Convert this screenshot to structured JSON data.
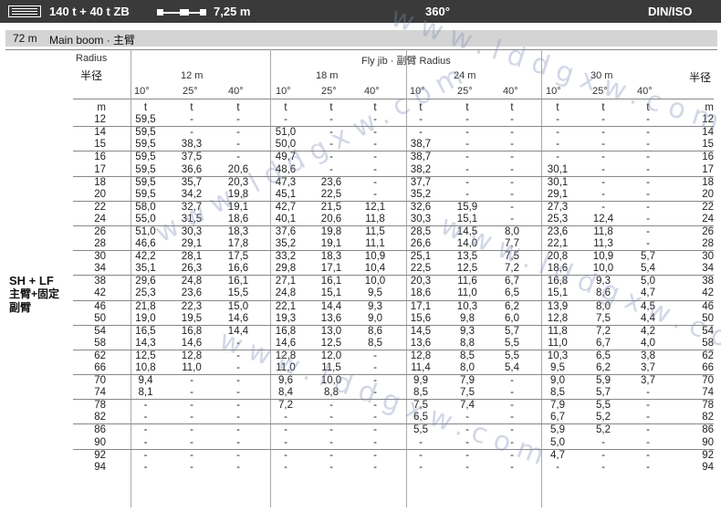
{
  "header": {
    "capacity": "140 t + 40 t ZB",
    "length": "7,25 m",
    "slew": "360°",
    "standard": "DIN/ISO"
  },
  "subheader": {
    "boom_length": "72 m",
    "boom_label": "Main boom · 主臂"
  },
  "table_header": {
    "radius_en": "Radius",
    "radius_cn": "半径",
    "fly_jib": "Fly jib · 副臂 Radius",
    "radius_cn_right": "半径",
    "jib_lengths": [
      "12 m",
      "18 m",
      "24 m",
      "30 m"
    ],
    "angles": [
      "10°",
      "25°",
      "40°",
      "10°",
      "25°",
      "40°",
      "10°",
      "25°",
      "40°",
      "10°",
      "25°",
      "40°"
    ],
    "unit_m": "m",
    "unit_t": "t"
  },
  "configuration": {
    "code": "SH + LF",
    "line1": "主臂+固定",
    "line2": "副臂"
  },
  "watermark": "www.lddgxw.com",
  "rows": [
    {
      "r": "12",
      "v": [
        "59,5",
        "-",
        "-",
        "-",
        "-",
        "-",
        "-",
        "-",
        "-",
        "-",
        "-",
        "-"
      ],
      "g": false
    },
    {
      "r": "14",
      "v": [
        "59,5",
        "-",
        "-",
        "51,0",
        "-",
        "-",
        "-",
        "-",
        "-",
        "-",
        "-",
        "-"
      ],
      "g": true
    },
    {
      "r": "15",
      "v": [
        "59,5",
        "38,3",
        "-",
        "50,0",
        "-",
        "-",
        "38,7",
        "-",
        "-",
        "-",
        "-",
        "-"
      ],
      "g": false
    },
    {
      "r": "16",
      "v": [
        "59,5",
        "37,5",
        "-",
        "49,7",
        "-",
        "-",
        "38,7",
        "-",
        "-",
        "-",
        "-",
        "-"
      ],
      "g": true
    },
    {
      "r": "17",
      "v": [
        "59,5",
        "36,6",
        "20,6",
        "48,6",
        "-",
        "-",
        "38,2",
        "-",
        "-",
        "30,1",
        "-",
        "-"
      ],
      "g": false
    },
    {
      "r": "18",
      "v": [
        "59,5",
        "35,7",
        "20,3",
        "47,3",
        "23,6",
        "-",
        "37,7",
        "-",
        "-",
        "30,1",
        "-",
        "-"
      ],
      "g": true
    },
    {
      "r": "20",
      "v": [
        "59,5",
        "34,2",
        "19,8",
        "45,1",
        "22,5",
        "-",
        "35,2",
        "-",
        "-",
        "29,1",
        "-",
        "-"
      ],
      "g": false
    },
    {
      "r": "22",
      "v": [
        "58,0",
        "32,7",
        "19,1",
        "42,7",
        "21,5",
        "12,1",
        "32,6",
        "15,9",
        "-",
        "27,3",
        "-",
        "-"
      ],
      "g": true
    },
    {
      "r": "24",
      "v": [
        "55,0",
        "31,5",
        "18,6",
        "40,1",
        "20,6",
        "11,8",
        "30,3",
        "15,1",
        "-",
        "25,3",
        "12,4",
        "-"
      ],
      "g": false
    },
    {
      "r": "26",
      "v": [
        "51,0",
        "30,3",
        "18,3",
        "37,6",
        "19,8",
        "11,5",
        "28,5",
        "14,5",
        "8,0",
        "23,6",
        "11,8",
        "-"
      ],
      "g": true
    },
    {
      "r": "28",
      "v": [
        "46,6",
        "29,1",
        "17,8",
        "35,2",
        "19,1",
        "11,1",
        "26,6",
        "14,0",
        "7,7",
        "22,1",
        "11,3",
        "-"
      ],
      "g": false
    },
    {
      "r": "30",
      "v": [
        "42,2",
        "28,1",
        "17,5",
        "33,2",
        "18,3",
        "10,9",
        "25,1",
        "13,5",
        "7,5",
        "20,8",
        "10,9",
        "5,7"
      ],
      "g": true
    },
    {
      "r": "34",
      "v": [
        "35,1",
        "26,3",
        "16,6",
        "29,8",
        "17,1",
        "10,4",
        "22,5",
        "12,5",
        "7,2",
        "18,6",
        "10,0",
        "5,4"
      ],
      "g": false
    },
    {
      "r": "38",
      "v": [
        "29,6",
        "24,8",
        "16,1",
        "27,1",
        "16,1",
        "10,0",
        "20,3",
        "11,6",
        "6,7",
        "16,8",
        "9,3",
        "5,0"
      ],
      "g": true
    },
    {
      "r": "42",
      "v": [
        "25,3",
        "23,6",
        "15,5",
        "24,8",
        "15,1",
        "9,5",
        "18,6",
        "11,0",
        "6,5",
        "15,1",
        "8,6",
        "4,7"
      ],
      "g": false
    },
    {
      "r": "46",
      "v": [
        "21,8",
        "22,3",
        "15,0",
        "22,1",
        "14,4",
        "9,3",
        "17,1",
        "10,3",
        "6,2",
        "13,9",
        "8,0",
        "4,5"
      ],
      "g": true
    },
    {
      "r": "50",
      "v": [
        "19,0",
        "19,5",
        "14,6",
        "19,3",
        "13,6",
        "9,0",
        "15,6",
        "9,8",
        "6,0",
        "12,8",
        "7,5",
        "4,4"
      ],
      "g": false
    },
    {
      "r": "54",
      "v": [
        "16,5",
        "16,8",
        "14,4",
        "16,8",
        "13,0",
        "8,6",
        "14,5",
        "9,3",
        "5,7",
        "11,8",
        "7,2",
        "4,2"
      ],
      "g": true
    },
    {
      "r": "58",
      "v": [
        "14,3",
        "14,6",
        "-",
        "14,6",
        "12,5",
        "8,5",
        "13,6",
        "8,8",
        "5,5",
        "11,0",
        "6,7",
        "4,0"
      ],
      "g": false
    },
    {
      "r": "62",
      "v": [
        "12,5",
        "12,8",
        "-",
        "12,8",
        "12,0",
        "-",
        "12,8",
        "8,5",
        "5,5",
        "10,3",
        "6,5",
        "3,8"
      ],
      "g": true
    },
    {
      "r": "66",
      "v": [
        "10,8",
        "11,0",
        "-",
        "11,0",
        "11,5",
        "-",
        "11,4",
        "8,0",
        "5,4",
        "9,5",
        "6,2",
        "3,7"
      ],
      "g": false
    },
    {
      "r": "70",
      "v": [
        "9,4",
        "-",
        "-",
        "9,6",
        "10,0",
        "-",
        "9,9",
        "7,9",
        "-",
        "9,0",
        "5,9",
        "3,7"
      ],
      "g": true
    },
    {
      "r": "74",
      "v": [
        "8,1",
        "-",
        "-",
        "8,4",
        "8,8",
        "-",
        "8,5",
        "7,5",
        "-",
        "8,5",
        "5,7",
        "-"
      ],
      "g": false
    },
    {
      "r": "78",
      "v": [
        "-",
        "-",
        "-",
        "7,2",
        "-",
        "-",
        "7,5",
        "7,4",
        "-",
        "7,9",
        "5,5",
        "-"
      ],
      "g": true
    },
    {
      "r": "82",
      "v": [
        "-",
        "-",
        "-",
        "-",
        "-",
        "-",
        "6,5",
        "-",
        "-",
        "6,7",
        "5,2",
        "-"
      ],
      "g": false
    },
    {
      "r": "86",
      "v": [
        "-",
        "-",
        "-",
        "-",
        "-",
        "-",
        "5,5",
        "-",
        "-",
        "5,9",
        "5,2",
        "-"
      ],
      "g": true
    },
    {
      "r": "90",
      "v": [
        "-",
        "-",
        "-",
        "-",
        "-",
        "-",
        "-",
        "-",
        "-",
        "5,0",
        "-",
        "-"
      ],
      "g": false
    },
    {
      "r": "92",
      "v": [
        "-",
        "-",
        "-",
        "-",
        "-",
        "-",
        "-",
        "-",
        "-",
        "4,7",
        "-",
        "-"
      ],
      "g": true
    },
    {
      "r": "94",
      "v": [
        "-",
        "-",
        "-",
        "-",
        "-",
        "-",
        "-",
        "-",
        "-",
        "-",
        "-",
        "-"
      ],
      "g": false
    }
  ]
}
